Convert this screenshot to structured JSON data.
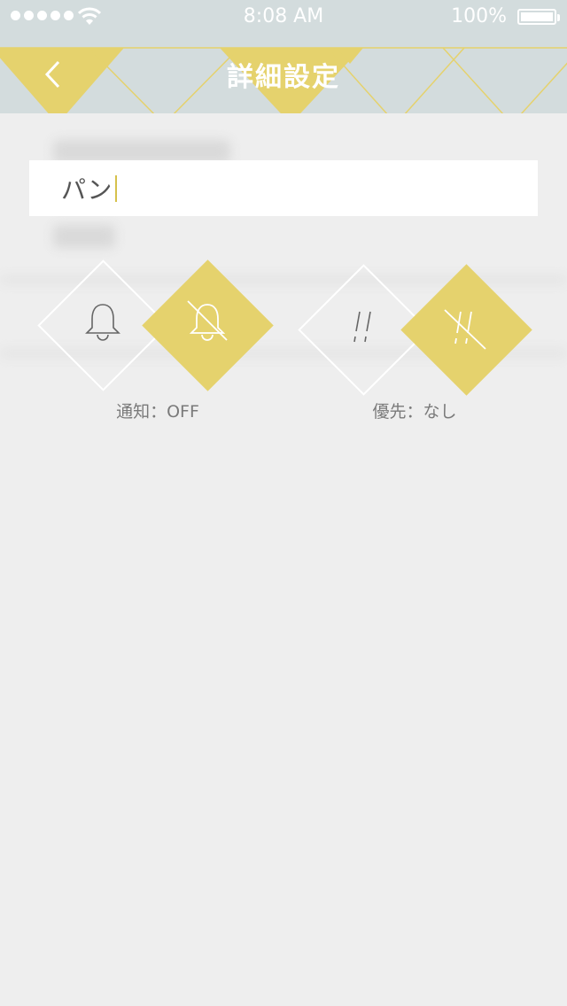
{
  "status_bar": {
    "time": "8:08 AM",
    "battery": "100%"
  },
  "nav": {
    "title": "詳細設定",
    "accent_color": "#e5d26d",
    "background_color": "#d3dcdd"
  },
  "item_field": {
    "value": "パン"
  },
  "notification": {
    "caption": "通知：OFF",
    "options": [
      "bell-icon",
      "bell-off-icon"
    ],
    "selected": "bell-off-icon"
  },
  "priority": {
    "caption": "優先：なし",
    "options": [
      "priority-icon",
      "priority-none-icon"
    ],
    "selected": "priority-none-icon"
  }
}
